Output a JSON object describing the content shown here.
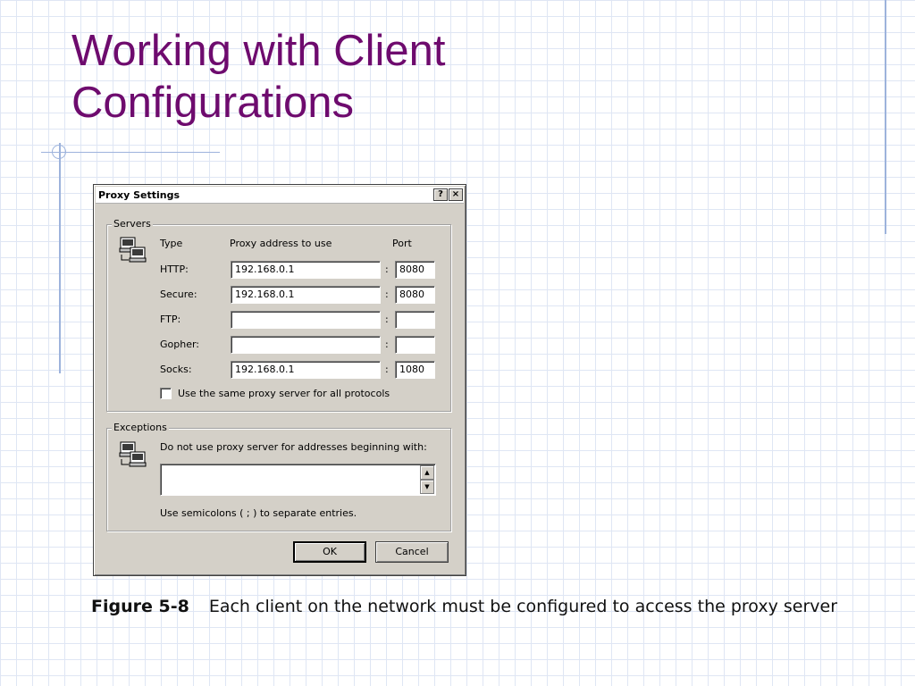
{
  "slide": {
    "title_line1": "Working with Client",
    "title_line2": "Configurations"
  },
  "dialog": {
    "title": "Proxy Settings",
    "help_button": "?",
    "close_button": "×",
    "servers": {
      "group_label": "Servers",
      "col_type": "Type",
      "col_address": "Proxy address to use",
      "col_port": "Port",
      "rows": [
        {
          "type": "HTTP:",
          "address": "192.168.0.1",
          "port": "8080"
        },
        {
          "type": "Secure:",
          "address": "192.168.0.1",
          "port": "8080"
        },
        {
          "type": "FTP:",
          "address": "",
          "port": ""
        },
        {
          "type": "Gopher:",
          "address": "",
          "port": ""
        },
        {
          "type": "Socks:",
          "address": "192.168.0.1",
          "port": "1080"
        }
      ],
      "separator": ":",
      "same_proxy_label": "Use the same proxy server for all protocols",
      "same_proxy_checked": false
    },
    "exceptions": {
      "group_label": "Exceptions",
      "prompt": "Do not use proxy server for addresses beginning with:",
      "value": "",
      "hint": "Use semicolons ( ; ) to separate entries."
    },
    "ok_label": "OK",
    "cancel_label": "Cancel"
  },
  "caption": {
    "figure_number": "Figure 5-8",
    "text": "Each client on the network must be configured to access the proxy server"
  },
  "colors": {
    "title": "#6e0b6e",
    "grid": "#dfe6f4",
    "accent_line": "#9db3dc",
    "dialog_face": "#d4d0c8"
  },
  "icons": {
    "servers_icon": "computers-icon",
    "exceptions_icon": "computers-icon"
  }
}
